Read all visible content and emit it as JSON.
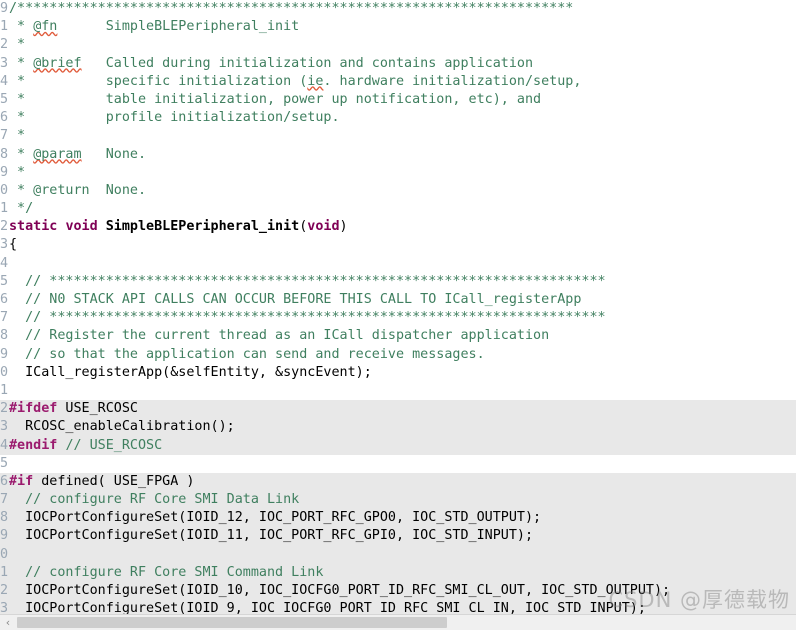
{
  "editor": {
    "language": "c",
    "background_color": "#ffffff",
    "inactive_block_color": "#e8e8e8",
    "comment_color": "#3f7f5f",
    "keyword_color": "#7f0055",
    "preprocessor_color": "#9b1b6e",
    "gutter_color": "#9aa7b4",
    "file_label": "SimpleBLEPeripheral_init"
  },
  "watermark": {
    "text": "CSDN @厚德载物"
  },
  "scrollbar": {
    "left_arrow": "‹"
  },
  "lines": [
    {
      "num": "9",
      "text": "/*********************************************************************"
    },
    {
      "num": "1",
      "text": " * @fn      SimpleBLEPeripheral_init"
    },
    {
      "num": "2",
      "text": " *"
    },
    {
      "num": "3",
      "text": " * @brief   Called during initialization and contains application"
    },
    {
      "num": "4",
      "text": " *          specific initialization (ie. hardware initialization/setup,"
    },
    {
      "num": "5",
      "text": " *          table initialization, power up notification, etc), and"
    },
    {
      "num": "6",
      "text": " *          profile initialization/setup."
    },
    {
      "num": "7",
      "text": " *"
    },
    {
      "num": "8",
      "text": " * @param   None."
    },
    {
      "num": "9",
      "text": " *"
    },
    {
      "num": "0",
      "text": " * @return  None."
    },
    {
      "num": "1",
      "text": " */"
    },
    {
      "num": "2",
      "text": "static void SimpleBLEPeripheral_init(void)"
    },
    {
      "num": "3",
      "text": "{"
    },
    {
      "num": "4",
      "text": ""
    },
    {
      "num": "5",
      "text": "  // *********************************************************************"
    },
    {
      "num": "6",
      "text": "  // N0 STACK API CALLS CAN OCCUR BEFORE THIS CALL TO ICall_registerApp"
    },
    {
      "num": "7",
      "text": "  // *********************************************************************"
    },
    {
      "num": "8",
      "text": "  // Register the current thread as an ICall dispatcher application"
    },
    {
      "num": "9",
      "text": "  // so that the application can send and receive messages."
    },
    {
      "num": "0",
      "text": "  ICall_registerApp(&selfEntity, &syncEvent);"
    },
    {
      "num": "1",
      "text": ""
    },
    {
      "num": "2",
      "text": "#ifdef USE_RCOSC"
    },
    {
      "num": "3",
      "text": "  RCOSC_enableCalibration();"
    },
    {
      "num": "4",
      "text": "#endif // USE_RCOSC"
    },
    {
      "num": "5",
      "text": ""
    },
    {
      "num": "6",
      "text": "#if defined( USE_FPGA )"
    },
    {
      "num": "7",
      "text": "  // configure RF Core SMI Data Link"
    },
    {
      "num": "8",
      "text": "  IOCPortConfigureSet(IOID_12, IOC_PORT_RFC_GPO0, IOC_STD_OUTPUT);"
    },
    {
      "num": "9",
      "text": "  IOCPortConfigureSet(IOID_11, IOC_PORT_RFC_GPI0, IOC_STD_INPUT);"
    },
    {
      "num": "0",
      "text": ""
    },
    {
      "num": "1",
      "text": "  // configure RF Core SMI Command Link"
    },
    {
      "num": "2",
      "text": "  IOCPortConfigureSet(IOID_10, IOC_IOCFG0_PORT_ID_RFC_SMI_CL_OUT, IOC_STD_OUTPUT);"
    },
    {
      "num": "3",
      "text": "  IOCPortConfigureSet(IOID_9, IOC_IOCFG0_PORT_ID_RFC_SMI_CL_IN, IOC_STD_INPUT);"
    }
  ],
  "line_styles": [
    {
      "kind": "comment",
      "inactive": false
    },
    {
      "kind": "doc-fn",
      "inactive": false
    },
    {
      "kind": "comment",
      "inactive": false
    },
    {
      "kind": "doc-brief",
      "inactive": false
    },
    {
      "kind": "doc-ie",
      "inactive": false
    },
    {
      "kind": "comment",
      "inactive": false
    },
    {
      "kind": "comment",
      "inactive": false
    },
    {
      "kind": "comment",
      "inactive": false
    },
    {
      "kind": "doc-param",
      "inactive": false
    },
    {
      "kind": "comment",
      "inactive": false
    },
    {
      "kind": "doc-return",
      "inactive": false
    },
    {
      "kind": "comment",
      "inactive": false
    },
    {
      "kind": "signature",
      "inactive": false
    },
    {
      "kind": "plain",
      "inactive": false
    },
    {
      "kind": "blank",
      "inactive": false
    },
    {
      "kind": "comment",
      "inactive": false
    },
    {
      "kind": "comment",
      "inactive": false
    },
    {
      "kind": "comment",
      "inactive": false
    },
    {
      "kind": "comment",
      "inactive": false
    },
    {
      "kind": "comment",
      "inactive": false
    },
    {
      "kind": "plain",
      "inactive": false
    },
    {
      "kind": "blank",
      "inactive": false
    },
    {
      "kind": "pp-ifdef",
      "inactive": true
    },
    {
      "kind": "plain",
      "inactive": true
    },
    {
      "kind": "pp-endif",
      "inactive": true
    },
    {
      "kind": "blank",
      "inactive": false
    },
    {
      "kind": "pp-if",
      "inactive": true
    },
    {
      "kind": "comment",
      "inactive": true
    },
    {
      "kind": "plain",
      "inactive": true
    },
    {
      "kind": "plain",
      "inactive": true
    },
    {
      "kind": "blank",
      "inactive": true
    },
    {
      "kind": "comment",
      "inactive": true
    },
    {
      "kind": "plain",
      "inactive": true
    },
    {
      "kind": "plain",
      "inactive": true
    }
  ]
}
